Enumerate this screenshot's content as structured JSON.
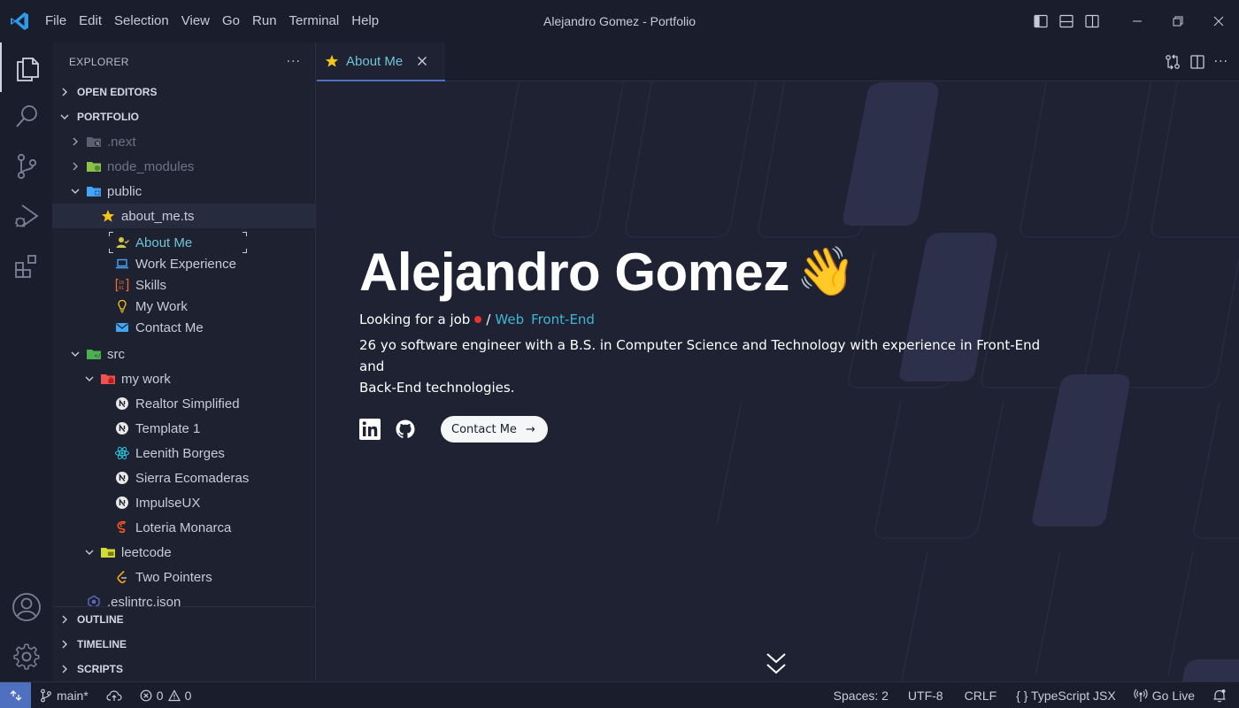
{
  "window": {
    "title": "Alejandro Gomez - Portfolio",
    "menu": [
      "File",
      "Edit",
      "Selection",
      "View",
      "Go",
      "Run",
      "Terminal",
      "Help"
    ]
  },
  "sidebar": {
    "title": "EXPLORER",
    "open_editors": "OPEN EDITORS",
    "portfolio": "PORTFOLIO",
    "tree": {
      "next": ".next",
      "node_modules": "node_modules",
      "public": "public",
      "about_file": "about_me.ts",
      "about_items": [
        "About Me",
        "Work Experience",
        "Skills",
        "My Work",
        "Contact Me"
      ],
      "src": "src",
      "my_work": "my work",
      "projects": [
        "Realtor Simplified",
        "Template 1",
        "Leenith Borges",
        "Sierra Ecomaderas",
        "ImpulseUX",
        "Loteria Monarca"
      ],
      "leetcode": "leetcode",
      "leetcode_items": [
        "Two Pointers"
      ],
      "eslint": ".eslintrc.json"
    },
    "bottom_sections": [
      "OUTLINE",
      "TIMELINE",
      "SCRIPTS"
    ]
  },
  "editor": {
    "tab_label": "About Me",
    "name": "Alejandro Gomez",
    "wave": "👋",
    "status": "Looking for a job",
    "slash": "/",
    "tags": [
      "Web",
      "Front-End"
    ],
    "bio_line1": "26 yo software engineer with a B.S. in Computer Science and Technology with experience in Front-End and",
    "bio_line2": "Back-End technologies.",
    "contact_label": "Contact Me",
    "contact_arrow": "→"
  },
  "statusbar": {
    "branch": "main*",
    "errors": "0",
    "warnings": "0",
    "spaces": "Spaces: 2",
    "encoding": "UTF-8",
    "eol": "CRLF",
    "language": "{ } TypeScript JSX",
    "golive": "Go Live"
  },
  "colors": {
    "accent": "#4f6fbf",
    "link": "#3fb6d2",
    "status_dot": "#e8332c",
    "background": "#1e2233"
  }
}
